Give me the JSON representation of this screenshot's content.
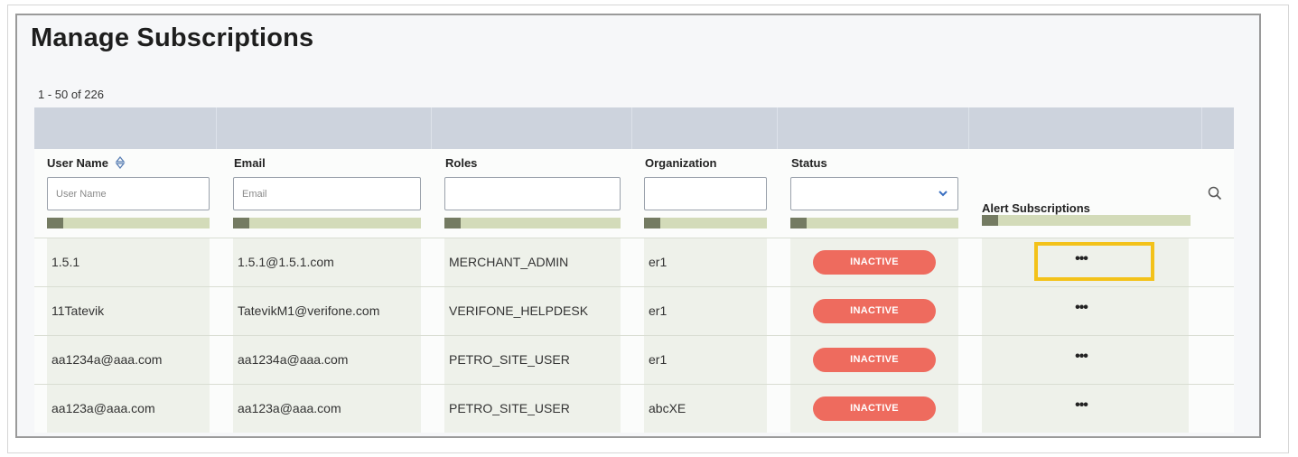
{
  "page": {
    "title": "Manage Subscriptions",
    "count": "1 - 50 of 226"
  },
  "columns": {
    "user_name": "User Name",
    "email": "Email",
    "roles": "Roles",
    "organization": "Organization",
    "status": "Status",
    "alert_subscriptions": "Alert Subscriptions"
  },
  "filters": {
    "user_name_placeholder": "User Name",
    "email_placeholder": "Email",
    "roles_value": "",
    "organization_value": "",
    "status_value": ""
  },
  "rows": [
    {
      "user_name": "1.5.1",
      "email": "1.5.1@1.5.1.com",
      "role": "MERCHANT_ADMIN",
      "organization": "er1",
      "status": "INACTIVE",
      "actions": "•••"
    },
    {
      "user_name": "11Tatevik",
      "email": "TatevikM1@verifone.com",
      "role": "VERIFONE_HELPDESK",
      "organization": "er1",
      "status": "INACTIVE",
      "actions": "•••"
    },
    {
      "user_name": "aa1234a@aaa.com",
      "email": "aa1234a@aaa.com",
      "role": "PETRO_SITE_USER",
      "organization": "er1",
      "status": "INACTIVE",
      "actions": "•••"
    },
    {
      "user_name": "aa123a@aaa.com",
      "email": "aa123a@aaa.com",
      "role": "PETRO_SITE_USER",
      "organization": "abcXE",
      "status": "INACTIVE",
      "actions": "•••"
    }
  ],
  "colors": {
    "inactive_badge": "#ee6b5e",
    "highlight": "#f3c21a",
    "header_band": "#cdd3dd"
  },
  "icons": {
    "sort": "sort-icon",
    "search": "search-icon",
    "dropdown": "chevron-down-icon"
  }
}
